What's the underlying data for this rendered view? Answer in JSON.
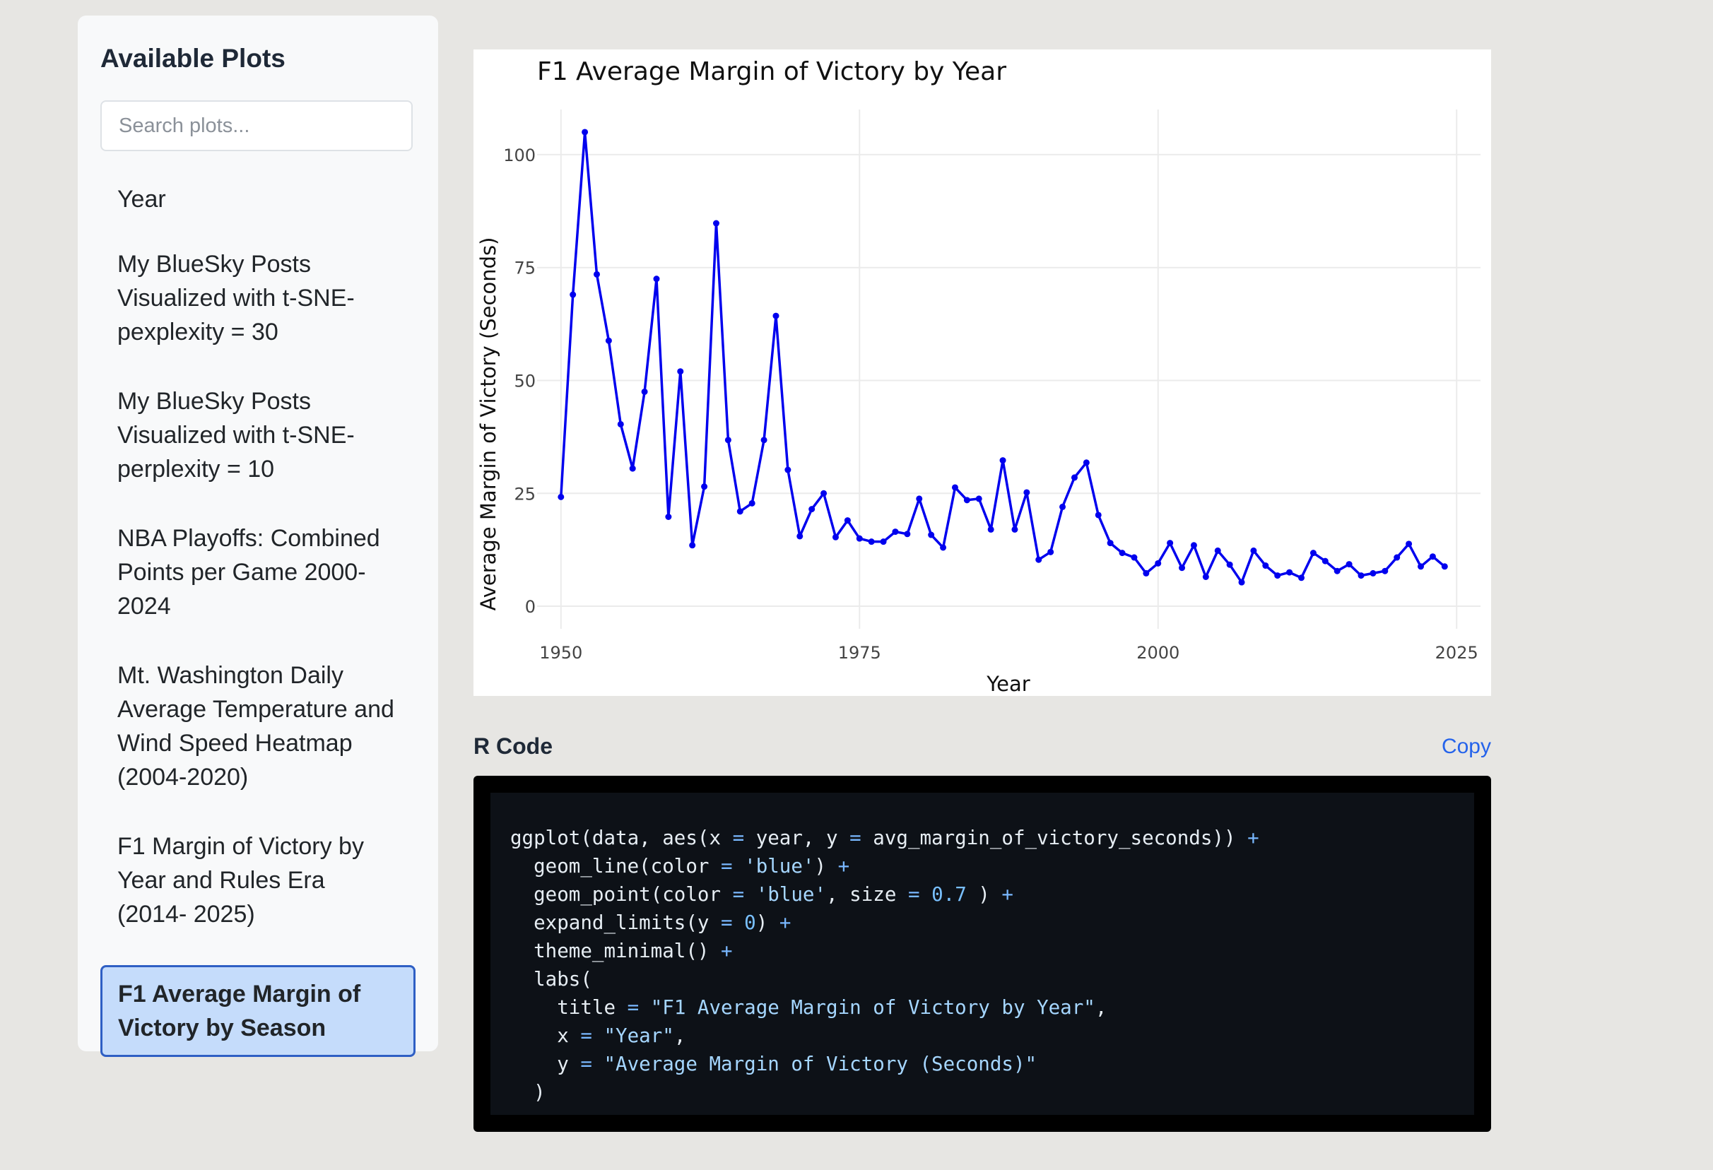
{
  "sidebar": {
    "title": "Available Plots",
    "search_placeholder": "Search plots...",
    "items": [
      {
        "label": "Year",
        "active": false
      },
      {
        "label": "My BlueSky Posts Visualized with t-SNE- pexplexity = 30",
        "active": false
      },
      {
        "label": "My BlueSky Posts Visualized with t-SNE- perplexity = 10",
        "active": false
      },
      {
        "label": "NBA Playoffs: Combined Points per Game 2000- 2024",
        "active": false
      },
      {
        "label": "Mt. Washington Daily Average Temperature and Wind Speed Heatmap (2004-2020)",
        "active": false
      },
      {
        "label": "F1 Margin of Victory by Year and Rules Era (2014- 2025)",
        "active": false
      },
      {
        "label": "F1 Average Margin of Victory by Season",
        "active": true
      }
    ]
  },
  "chart_data": {
    "type": "line",
    "title": "F1 Average Margin of Victory by Year",
    "xlabel": "Year",
    "ylabel": "Average Margin of Victory (Seconds)",
    "xlim": [
      1948,
      2027
    ],
    "ylim": [
      -5,
      110
    ],
    "xticks": [
      1950,
      1975,
      2000,
      2025
    ],
    "yticks": [
      0,
      25,
      50,
      75,
      100
    ],
    "grid": true,
    "line_color": "#0000ee",
    "x": [
      1950,
      1951,
      1952,
      1953,
      1954,
      1955,
      1956,
      1957,
      1958,
      1959,
      1960,
      1961,
      1962,
      1963,
      1964,
      1965,
      1966,
      1967,
      1968,
      1969,
      1970,
      1971,
      1972,
      1973,
      1974,
      1975,
      1976,
      1977,
      1978,
      1979,
      1980,
      1981,
      1982,
      1983,
      1984,
      1985,
      1986,
      1987,
      1988,
      1989,
      1990,
      1991,
      1992,
      1993,
      1994,
      1995,
      1996,
      1997,
      1998,
      1999,
      2000,
      2001,
      2002,
      2003,
      2004,
      2005,
      2006,
      2007,
      2008,
      2009,
      2010,
      2011,
      2012,
      2013,
      2014,
      2015,
      2016,
      2017,
      2018,
      2019,
      2020,
      2021,
      2022,
      2023,
      2024
    ],
    "y": [
      24.2,
      69,
      105,
      73.5,
      58.8,
      40.3,
      30.5,
      47.5,
      72.5,
      19.8,
      52,
      13.5,
      26.5,
      84.8,
      36.8,
      21,
      22.8,
      36.8,
      64.3,
      30.2,
      15.5,
      21.5,
      25,
      15.3,
      19,
      15,
      14.3,
      14.3,
      16.5,
      16,
      23.8,
      15.8,
      13,
      26.3,
      23.5,
      23.8,
      17,
      32.3,
      17,
      25.2,
      10.3,
      12,
      22,
      28.5,
      31.8,
      20.2,
      14,
      11.8,
      10.8,
      7.3,
      9.5,
      14,
      8.5,
      13.5,
      6.5,
      12.3,
      9.2,
      5.3,
      12.3,
      9,
      6.8,
      7.5,
      6.3,
      11.8,
      10,
      7.8,
      9.3,
      6.8,
      7.3,
      7.8,
      10.8,
      13.8,
      8.8,
      11,
      8.8
    ]
  },
  "code_section": {
    "title": "R Code",
    "copy_label": "Copy",
    "lines": [
      [
        {
          "t": "ggplot(data, aes(x "
        },
        {
          "t": "=",
          "c": "op"
        },
        {
          "t": " year, y "
        },
        {
          "t": "=",
          "c": "op"
        },
        {
          "t": " avg_margin_of_victory_seconds)) "
        },
        {
          "t": "+",
          "c": "op"
        }
      ],
      [
        {
          "t": "  geom_line(color "
        },
        {
          "t": "=",
          "c": "op"
        },
        {
          "t": " "
        },
        {
          "t": "'blue'",
          "c": "str"
        },
        {
          "t": ") "
        },
        {
          "t": "+",
          "c": "op"
        }
      ],
      [
        {
          "t": "  geom_point(color "
        },
        {
          "t": "=",
          "c": "op"
        },
        {
          "t": " "
        },
        {
          "t": "'blue'",
          "c": "str"
        },
        {
          "t": ", size "
        },
        {
          "t": "=",
          "c": "op"
        },
        {
          "t": " "
        },
        {
          "t": "0.7",
          "c": "num"
        },
        {
          "t": " ) "
        },
        {
          "t": "+",
          "c": "op"
        }
      ],
      [
        {
          "t": "  expand_limits(y "
        },
        {
          "t": "=",
          "c": "op"
        },
        {
          "t": " "
        },
        {
          "t": "0",
          "c": "num"
        },
        {
          "t": ") "
        },
        {
          "t": "+",
          "c": "op"
        }
      ],
      [
        {
          "t": "  theme_minimal() "
        },
        {
          "t": "+",
          "c": "op"
        }
      ],
      [
        {
          "t": "  labs("
        }
      ],
      [
        {
          "t": "    title "
        },
        {
          "t": "=",
          "c": "op"
        },
        {
          "t": " "
        },
        {
          "t": "\"F1 Average Margin of Victory by Year\"",
          "c": "str"
        },
        {
          "t": ","
        }
      ],
      [
        {
          "t": "    x "
        },
        {
          "t": "=",
          "c": "op"
        },
        {
          "t": " "
        },
        {
          "t": "\"Year\"",
          "c": "str"
        },
        {
          "t": ","
        }
      ],
      [
        {
          "t": "    y "
        },
        {
          "t": "=",
          "c": "op"
        },
        {
          "t": " "
        },
        {
          "t": "\"Average Margin of Victory (Seconds)\"",
          "c": "str"
        }
      ],
      [
        {
          "t": "  )"
        }
      ]
    ]
  }
}
